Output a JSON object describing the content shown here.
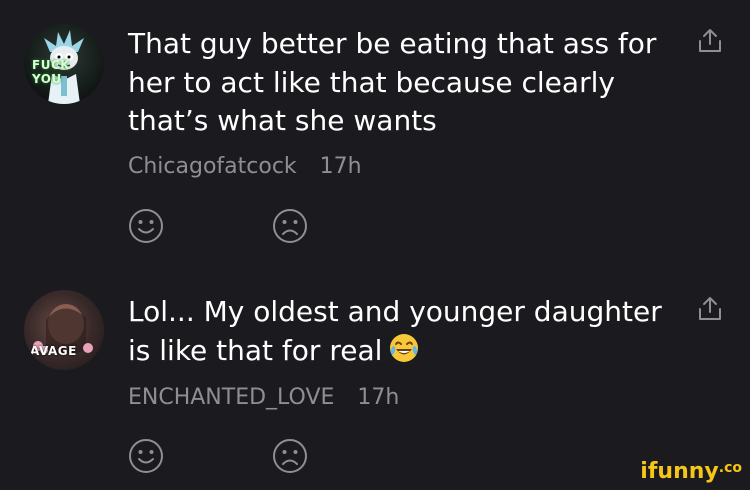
{
  "comments": [
    {
      "avatar_text": "FUCK YOU",
      "text": "That guy better be eating that ass for her to act like that because clearly that’s what she wants",
      "username": "Chicagofatcock",
      "time": "17h"
    },
    {
      "avatar_text": "AVAGE",
      "text": "Lol... My oldest and younger daughter is like that for real",
      "username": "ENCHANTED_LOVE",
      "time": "17h"
    }
  ],
  "icons": {
    "share": "share-icon",
    "like": "smile-icon",
    "dislike": "frown-icon",
    "emoji": "tears-of-joy-emoji"
  },
  "watermark": {
    "main": "ifunny",
    "suffix": ".co"
  },
  "colors": {
    "background": "#1b1b1f",
    "text": "#ffffff",
    "meta": "#8e8e93",
    "icon": "#8e8e93",
    "watermark": "#f5c518"
  }
}
